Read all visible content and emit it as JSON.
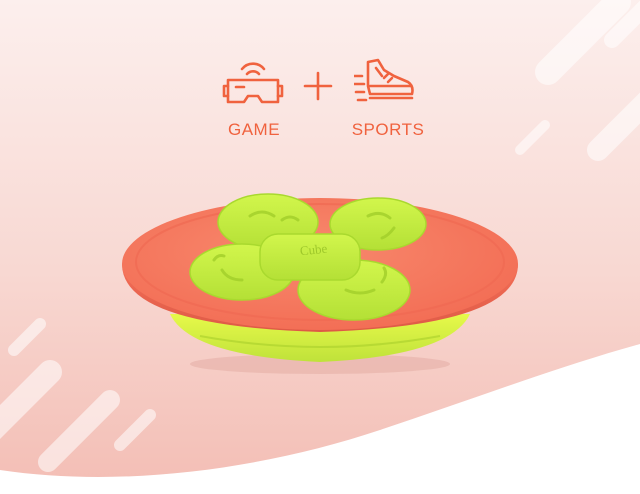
{
  "colors": {
    "background_top": "#fae9e6",
    "background_bottom": "#f4c0b8",
    "wave_white": "#ffffff",
    "accent": "#f0623e",
    "board_orange": "#f56c55",
    "board_orange_dark": "#e9594a",
    "board_green": "#c6f13e",
    "board_green_dark": "#a9d92e",
    "base_yellow": "#d8f23a"
  },
  "features": {
    "game_label": "GAME",
    "game_icon": "vr-headset-icon",
    "plus_icon": "plus-icon",
    "sports_label": "SPORTS",
    "sports_icon": "running-shoe-icon"
  },
  "product": {
    "name": "balance-board",
    "logo_text": "Cube"
  }
}
